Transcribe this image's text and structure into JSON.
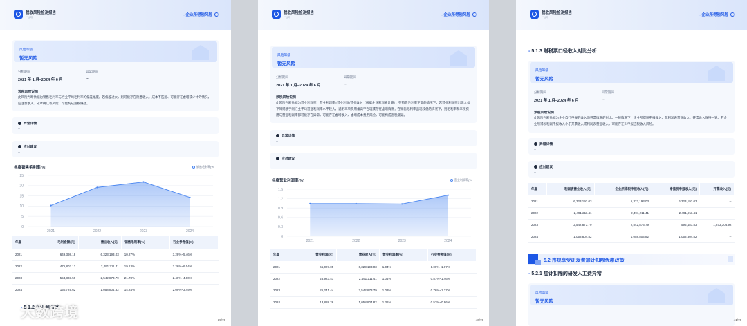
{
  "brand": {
    "title": "税收风险检测报告",
    "subtitle": "**公司"
  },
  "header_right": "企业所得税风险",
  "colors": {
    "accent": "#1d57e5",
    "line": "#4a86f0"
  },
  "common": {
    "risk_label": "风险等级",
    "risk_value": "暂无风险",
    "period_key": "分析期间",
    "period_value": "2021 年 1 月–2024 年 6 月",
    "range_key": "异常期间",
    "range_value": "--",
    "anomaly_title": "异常详情",
    "anomaly_value": "--",
    "advice_title": "应对建议",
    "advice_value": "--",
    "explain_title": "涉税风险说明"
  },
  "page1": {
    "desc": "此风险判断依据为销售毛利率与行业平均毛利率的偏差幅度。若偏差过大，则可能存在隐匿收入、成本不匹配、可能存在虚增或少计的情况，应注意收入、成本确认等风险，可能构成逃税嫌疑。",
    "chart_title": "年度销售毛利率(%)",
    "legend": "销售毛利率(%)",
    "table_headers": [
      "年度",
      "毛利金额(元)",
      "营业收入(元)",
      "销售毛利率(%)",
      "行业参考值(%)"
    ],
    "rows": [
      [
        "2021",
        "649,398.18",
        "6,323,193.03",
        "10.27%",
        "3.28%~5.46%"
      ],
      [
        "2022",
        "476,803.12",
        "2,491,211.41",
        "19.13%",
        "3.26%~6.04%"
      ],
      [
        "2023",
        "553,803.59",
        "2,542,873.79",
        "21.78%",
        "2.40%~4.00%"
      ],
      [
        "2024",
        "150,729.62",
        "1,058,804.82",
        "14.24%",
        "2.09%~3.49%"
      ]
    ],
    "next_section": "5.1.2 营业利润率",
    "page_num": "39/70"
  },
  "page2": {
    "desc": "此风险判断依据为营业利润率，营业利润率=营业利润/营业收入（根据企业利润表计算）；在销售毛利率正常的情况下，若营业利润率出现大幅下降或低于同行业平均营业利润率水平较大，说明三项费用偏高不合理或存在虚增情况；在销售毛利率出现较低的情况下，则毛利率和三项费用与营业利润率都可能存在异常，可能存在虚增收入、虚增成本费用风险，可能构成逃税嫌疑。",
    "chart_title": "年度营业利润率(%)",
    "legend": "营业利润率(%)",
    "table_headers": [
      "年度",
      "营业利润(元)",
      "营业收入(元)",
      "营业利润率(%)",
      "行业参考值(%)"
    ],
    "rows": [
      [
        "2021",
        "66,027.05",
        "6,323,193.03",
        "1.04%",
        "1.00%~1.67%"
      ],
      [
        "2022",
        "25,923.41",
        "2,491,211.41",
        "1.04%",
        "0.87%~1.46%"
      ],
      [
        "2023",
        "26,241.44",
        "2,542,873.79",
        "1.03%",
        "0.76%~1.27%"
      ],
      [
        "2024",
        "13,888.26",
        "1,058,804.82",
        "1.31%",
        "0.57%~0.96%"
      ]
    ],
    "page_num": "40/70"
  },
  "page3": {
    "heading": "5.1.3 财税票口径收入对比分析",
    "desc": "此风险判断依据为企业自行申报的收入与开票情况的对比。一般情况下，企业所得税申报收入、与利润表营业收入、开票收入保持一致。若企业所得税利润申报收入小于开票收入或利润表营业收入，可能存在少申报应税收入风险。",
    "table_headers": [
      "年度",
      "利润表营业收入(元)",
      "企业所得税申报收入(元)",
      "增值税申报收入(元)",
      "开票收入(元)"
    ],
    "rows": [
      [
        "2021",
        "6,323,193.03",
        "6,323,193.03",
        "6,323,193.03",
        "--"
      ],
      [
        "2022",
        "2,491,211.41",
        "2,491,211.41",
        "2,491,211.41",
        "--"
      ],
      [
        "2023",
        "2,542,873.79",
        "2,542,873.79",
        "596,481.83",
        "1,873,306.92"
      ],
      [
        "2024",
        "1,058,804.82",
        "1,058,804.82",
        "1,058,804.82",
        "--"
      ]
    ],
    "band_title": "5.2 违规享受研发费加计扣除优惠政策",
    "sub_heading": "5.2.1 加计扣除的研发人工费异常",
    "page_num": "41/70"
  },
  "watermark": "大数跨境",
  "chart_data": [
    {
      "type": "area",
      "title": "年度销售毛利率(%)",
      "series": [
        {
          "name": "销售毛利率(%)",
          "values": [
            10.27,
            19.13,
            21.78,
            14.24
          ]
        }
      ],
      "categories": [
        "2021",
        "2022",
        "2023",
        "2024"
      ],
      "ylim": [
        0,
        25
      ],
      "yticks": [
        0,
        5,
        10,
        15,
        20,
        25
      ],
      "legend": "top-right"
    },
    {
      "type": "area",
      "title": "年度营业利润率(%)",
      "series": [
        {
          "name": "营业利润率(%)",
          "values": [
            1.04,
            1.04,
            1.03,
            1.31
          ]
        }
      ],
      "categories": [
        "2021",
        "2022",
        "2023",
        "2024"
      ],
      "ylim": [
        0,
        1.5
      ],
      "yticks": [
        0,
        0.3,
        0.6,
        0.9,
        1.2,
        1.5
      ],
      "legend": "top-right"
    }
  ]
}
